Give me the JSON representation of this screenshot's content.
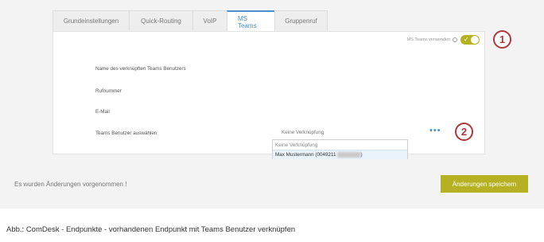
{
  "tabs": [
    {
      "label": "Grundeinstellungen"
    },
    {
      "label": "Quick-Routing"
    },
    {
      "label": "VoIP"
    },
    {
      "label": "MS Teams"
    },
    {
      "label": "Gruppenruf"
    }
  ],
  "panel": {
    "toggle_label": "MS Teams verwenden",
    "info_icon": "i",
    "toggle_check": "✓",
    "fields": {
      "teams_user_name": "Name des verknüpften Teams Benutzers",
      "phone_number": "Rufnummer",
      "email": "E-Mail",
      "select_teams_user": "Teams Benutzer auswählen"
    },
    "select_value": "Keine Verknüpfung",
    "more_icon": "•••",
    "dropdown_options": [
      "Keine Verknüpfung",
      "Max Mustermann (0049211"
    ],
    "dropdown_closing": ")"
  },
  "callouts": {
    "one": "1",
    "two": "2"
  },
  "footer": {
    "status_text": "Es wurden Änderungen vorgenommen !",
    "save_label": "Änderungen speichern"
  },
  "caption": "Abb.: ComDesk - Endpunkte - vorhandenen Endpunkt mit Teams Benutzer verknüpfen",
  "colors": {
    "accent": "#b6b023",
    "tab_active": "#4b8fc8",
    "callout": "#a93b3b"
  }
}
